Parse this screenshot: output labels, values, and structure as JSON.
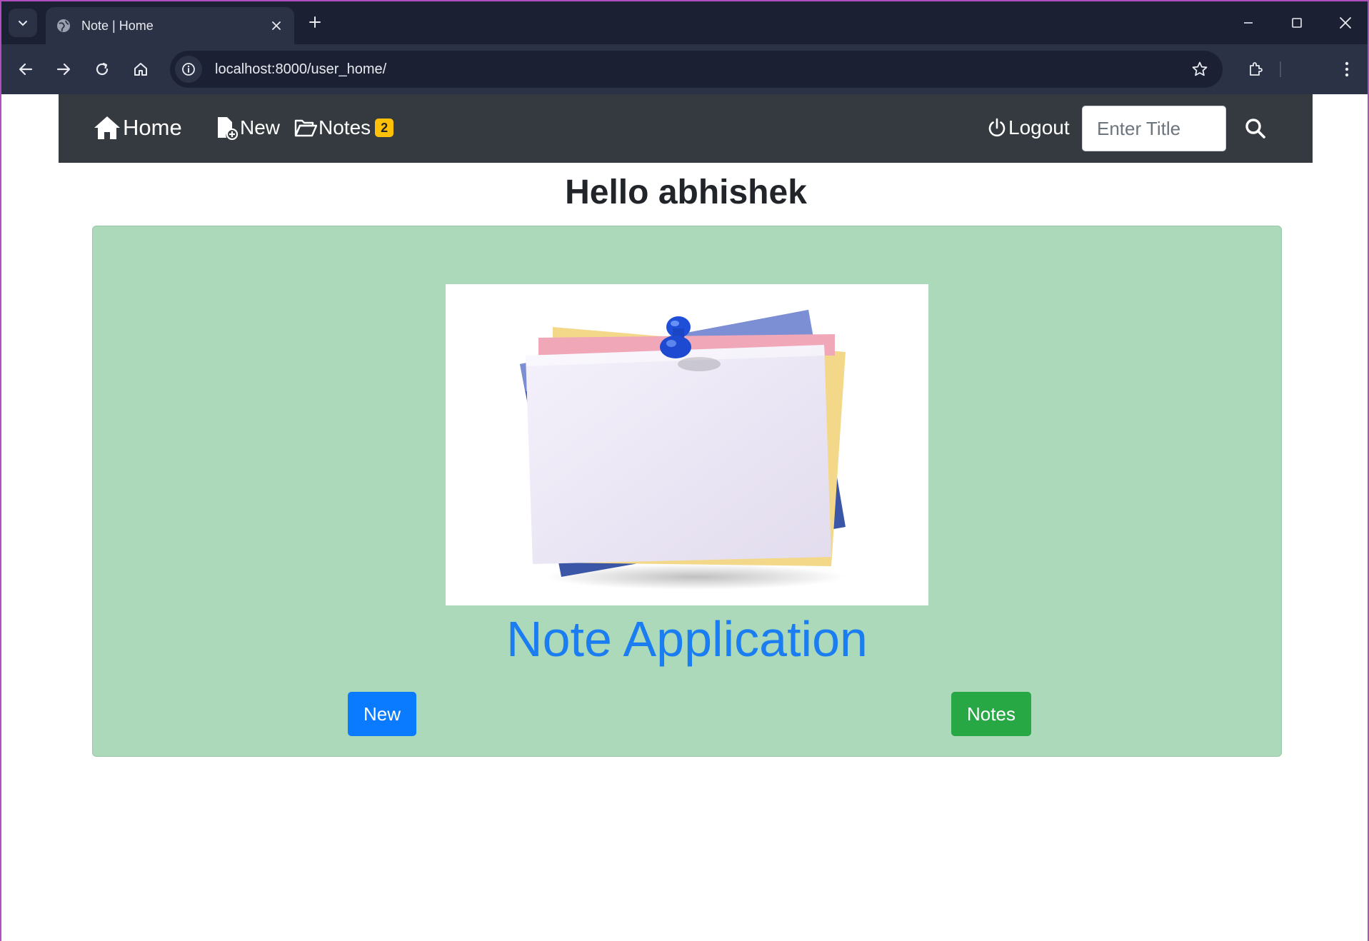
{
  "browser": {
    "tab_title": "Note | Home",
    "url": "localhost:8000/user_home/"
  },
  "navbar": {
    "home_label": "Home",
    "new_label": "New",
    "notes_label": "Notes",
    "notes_count": "2",
    "logout_label": "Logout",
    "search_placeholder": "Enter Title"
  },
  "greeting": {
    "prefix": "Hello",
    "username": "abhishek"
  },
  "jumbotron": {
    "title": "Note Application",
    "new_button": "New",
    "notes_button": "Notes"
  },
  "colors": {
    "navbar_bg": "#343a40",
    "jumbotron_bg": "#abd9b9",
    "title_color": "#1a7ef2",
    "new_button_bg": "#0a7bff",
    "notes_button_bg": "#28a745",
    "badge_bg": "#ffc107"
  }
}
